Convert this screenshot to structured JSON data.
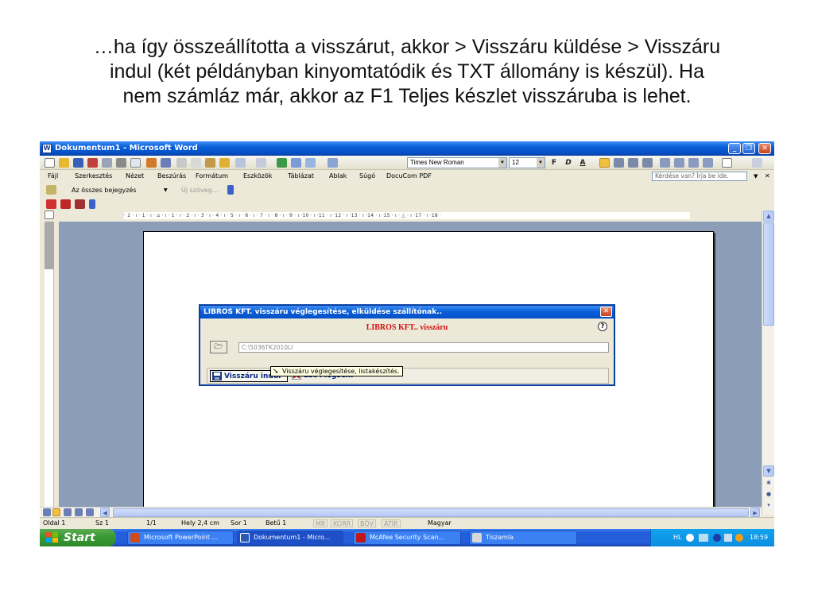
{
  "caption": {
    "line1": "…ha így összeállította a visszárut, akkor > Visszáru küldése > Visszáru",
    "line2": "indul (két példányban kinyomtatódik és TXT állomány is készül). Ha",
    "line3": "nem számláz már, akkor az F1 Teljes készlet visszáruba is lehet."
  },
  "window": {
    "title": "Dokumentum1 - Microsoft Word"
  },
  "formatting": {
    "font_name": "Times New Roman",
    "font_size": "12",
    "bold": "F",
    "italic": "D",
    "underline": "A"
  },
  "menu": {
    "items": [
      "Fájl",
      "Szerkesztés",
      "Nézet",
      "Beszúrás",
      "Formátum",
      "Eszközök",
      "Táblázat",
      "Ablak",
      "Súgó",
      "DocuCom PDF"
    ],
    "help_placeholder": "Kérdése van? Írja be ide."
  },
  "reviewing": {
    "show_label": "Az összes bejegyzés",
    "new_comment": "Új szöveg..."
  },
  "ruler": {
    "h_text": "· 2 · ı · 1 · ı · ⌂ · ı · 1 · ı · 2 · ı · 3 · ı · 4 · ı · 5 · ı · 6 · ı · 7 · ı · 8 · ı · 9 · ı ·10 · ı ·11 · ı ·12 · ı ·13 · ı ·14 · ı ·15 · ı · △ · ı ·17 · ı ·18 ·"
  },
  "dialog": {
    "title": "LIBROS KFT. visszáru véglegesítése, elküldése szállítónak..",
    "heading": "LIBROS KFT.. visszáru",
    "path_value": "C:\\5036TK2010LI",
    "primary_button": "Visszáru indul",
    "secondary_button": "Esc Mégsem",
    "tooltip": "Visszáru véglegesítése, listakészítés."
  },
  "status": {
    "page": "Oldal 1",
    "section": "Sz 1",
    "pages": "1/1",
    "position": "Hely 2,4 cm",
    "line": "Sor 1",
    "column": "Betű 1",
    "rec": "MR",
    "trk": "KORR",
    "ext": "BŐV",
    "ovr": "ÁTÍR",
    "language": "Magyar"
  },
  "taskbar": {
    "start": "Start",
    "tasks": [
      "Microsoft PowerPoint ...",
      "Dokumentum1 - Micro...",
      "McAfee Security Scan...",
      "Tiszamla"
    ],
    "tray_lang": "HL",
    "clock": "18:59"
  },
  "colors": {
    "xp_blue": "#0a5fd8",
    "dialog_heading": "#d01010",
    "doc_background": "#8c9db8"
  }
}
